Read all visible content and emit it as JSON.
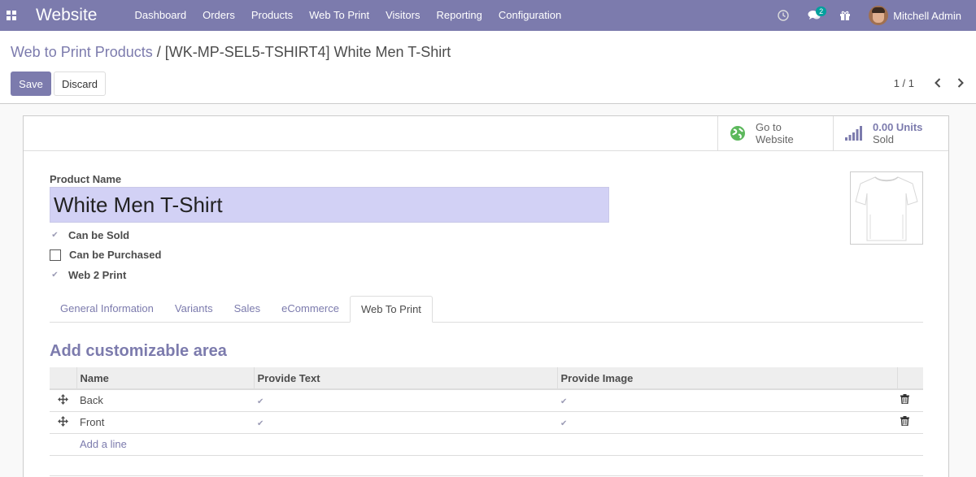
{
  "navbar": {
    "app_title": "Website",
    "menu": [
      "Dashboard",
      "Orders",
      "Products",
      "Web To Print",
      "Visitors",
      "Reporting",
      "Configuration"
    ],
    "messages_badge": "2",
    "user_name": "Mitchell Admin",
    "icons": [
      "apps-icon",
      "clock-icon",
      "chat-icon",
      "gift-icon"
    ]
  },
  "control_panel": {
    "breadcrumb_parent": "Web to Print Products",
    "breadcrumb_separator": "/",
    "breadcrumb_current": "[WK-MP-SEL5-TSHIRT4] White Men T-Shirt",
    "save_label": "Save",
    "discard_label": "Discard",
    "pager": "1 / 1"
  },
  "button_box": {
    "website_label": "Go to\nWebsite",
    "website_line1": "Go to",
    "website_line2": "Website",
    "sold_value": "0.00 Units",
    "sold_label": "Sold"
  },
  "form": {
    "product_name_label": "Product Name",
    "product_name": "White Men T-Shirt",
    "checkboxes": [
      {
        "label": "Can be Sold",
        "checked": true
      },
      {
        "label": "Can be Purchased",
        "checked": false
      },
      {
        "label": "Web 2 Print",
        "checked": true
      }
    ]
  },
  "tabs": [
    "General Information",
    "Variants",
    "Sales",
    "eCommerce",
    "Web To Print"
  ],
  "active_tab": "Web To Print",
  "section": {
    "title": "Add customizable area",
    "columns": [
      "Name",
      "Provide Text",
      "Provide Image"
    ],
    "rows": [
      {
        "name": "Back",
        "provide_text": true,
        "provide_image": true
      },
      {
        "name": "Front",
        "provide_text": true,
        "provide_image": true
      }
    ],
    "add_line_label": "Add a line"
  },
  "colors": {
    "brand": "#7c7bad",
    "input_highlight": "#d2d1f5"
  }
}
